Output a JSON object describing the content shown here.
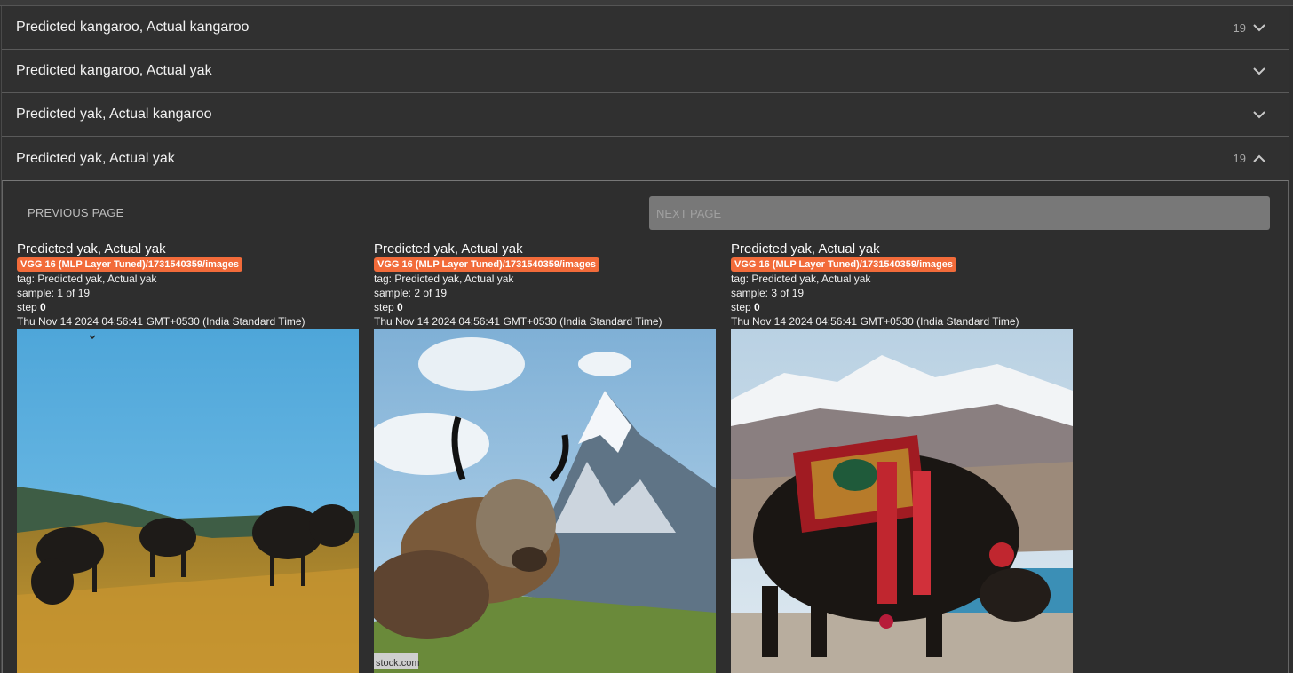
{
  "accordion": [
    {
      "title": "Predicted kangaroo, Actual kangaroo",
      "count": "19",
      "state": "collapsed"
    },
    {
      "title": "Predicted kangaroo, Actual yak",
      "count": "",
      "state": "collapsed"
    },
    {
      "title": "Predicted yak, Actual kangaroo",
      "count": "",
      "state": "collapsed"
    },
    {
      "title": "Predicted yak, Actual yak",
      "count": "19",
      "state": "expanded"
    }
  ],
  "pager": {
    "prev_label": "PREVIOUS PAGE",
    "next_label": "NEXT PAGE"
  },
  "cards": [
    {
      "title": "Predicted yak, Actual yak",
      "run": "VGG 16 (MLP Layer Tuned)/1731540359/images",
      "tag": "tag: Predicted yak, Actual yak",
      "sample": "sample: 1 of 19",
      "step_label": "step",
      "step_value": "0",
      "timestamp": "Thu Nov 14 2024 04:56:41 GMT+0530 (India Standard Time)"
    },
    {
      "title": "Predicted yak, Actual yak",
      "run": "VGG 16 (MLP Layer Tuned)/1731540359/images",
      "tag": "tag: Predicted yak, Actual yak",
      "sample": "sample: 2 of 19",
      "step_label": "step",
      "step_value": "0",
      "timestamp": "Thu Nov 14 2024 04:56:41 GMT+0530 (India Standard Time)",
      "watermark": "stock.com"
    },
    {
      "title": "Predicted yak, Actual yak",
      "run": "VGG 16 (MLP Layer Tuned)/1731540359/images",
      "tag": "tag: Predicted yak, Actual yak",
      "sample": "sample: 3 of 19",
      "step_label": "step",
      "step_value": "0",
      "timestamp": "Thu Nov 14 2024 04:56:41 GMT+0530 (India Standard Time)"
    }
  ],
  "colors": {
    "badge": "#f26b3a",
    "background": "#2f2f2f"
  }
}
